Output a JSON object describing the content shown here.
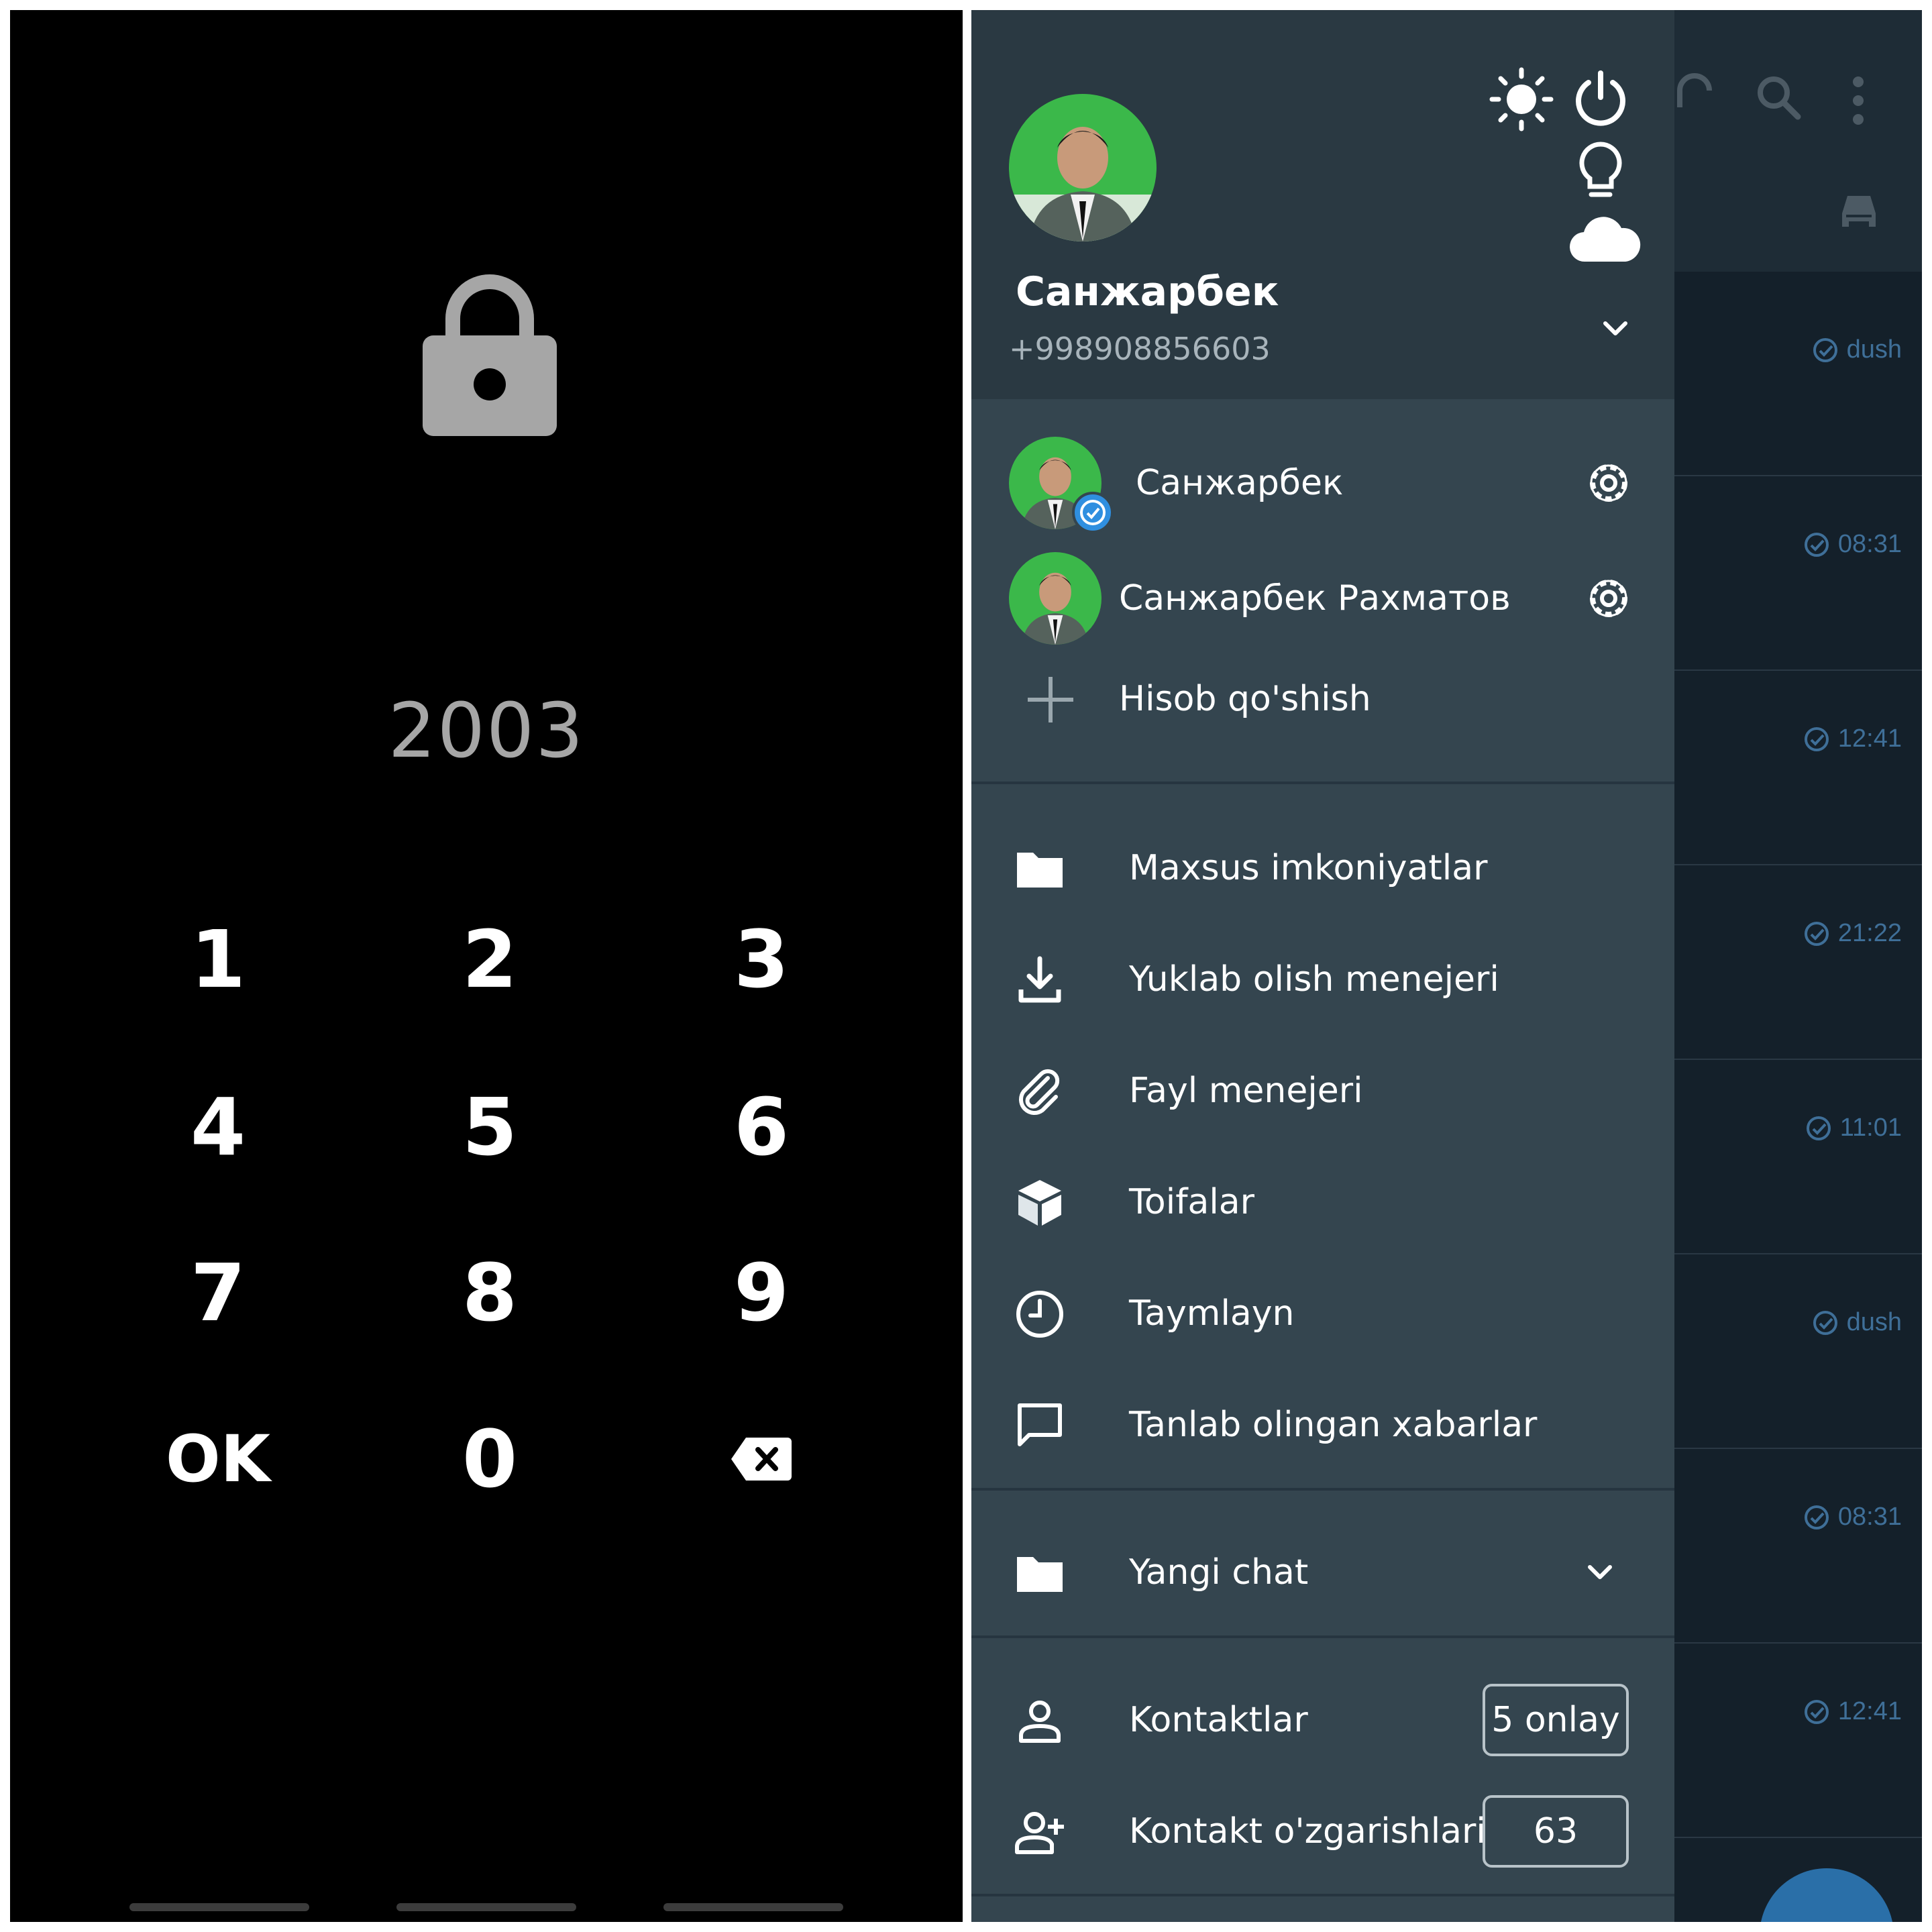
{
  "lock_screen": {
    "pin_value": "2003",
    "keys": {
      "k1": "1",
      "k2": "2",
      "k3": "3",
      "k4": "4",
      "k5": "5",
      "k6": "6",
      "k7": "7",
      "k8": "8",
      "k9": "9",
      "ok": "OK",
      "k0": "0"
    },
    "icons": [
      "lock-icon",
      "backspace-icon"
    ]
  },
  "drawer": {
    "header": {
      "name": "Санжарбек",
      "phone": "+998908856603",
      "icons": [
        "sun-icon",
        "power-icon",
        "lightbulb-icon",
        "cloud-icon",
        "chevron-down-icon"
      ]
    },
    "accounts": [
      {
        "name": "Санжарбек",
        "verified": true
      },
      {
        "name": "Санжарбек Рахматов",
        "verified": false
      }
    ],
    "add_account": "Hisob qo'shish",
    "menu": [
      {
        "label": "Maxsus imkoniyatlar",
        "icon": "folder-icon"
      },
      {
        "label": "Yuklab olish menejeri",
        "icon": "download-icon"
      },
      {
        "label": "Fayl menejeri",
        "icon": "paperclip-icon"
      },
      {
        "label": "Toifalar",
        "icon": "cube-icon"
      },
      {
        "label": "Taymlayn",
        "icon": "clock-icon"
      },
      {
        "label": "Tanlab olingan xabarlar",
        "icon": "chat-bubble-icon"
      }
    ],
    "folder": {
      "label": "Yangi chat",
      "icon": "folder-icon"
    },
    "contacts": {
      "label": "Kontaktlar",
      "badge": "5 onlay",
      "icon": "person-icon"
    },
    "contact_changes": {
      "label": "Kontakt o'zgarishlari",
      "badge": "63",
      "icon": "person-add-icon"
    }
  },
  "background_chats": {
    "times": [
      "dush",
      "08:31",
      "12:41",
      "21:22",
      "11:01",
      "dush",
      "08:31",
      "12:41"
    ]
  },
  "colors": {
    "lock_bg": "#000000",
    "drawer_bg": "#34454f",
    "drawer_header_bg": "#2a3942",
    "accent_blue": "#2f8fe0",
    "avatar_green": "#3bb84a"
  }
}
